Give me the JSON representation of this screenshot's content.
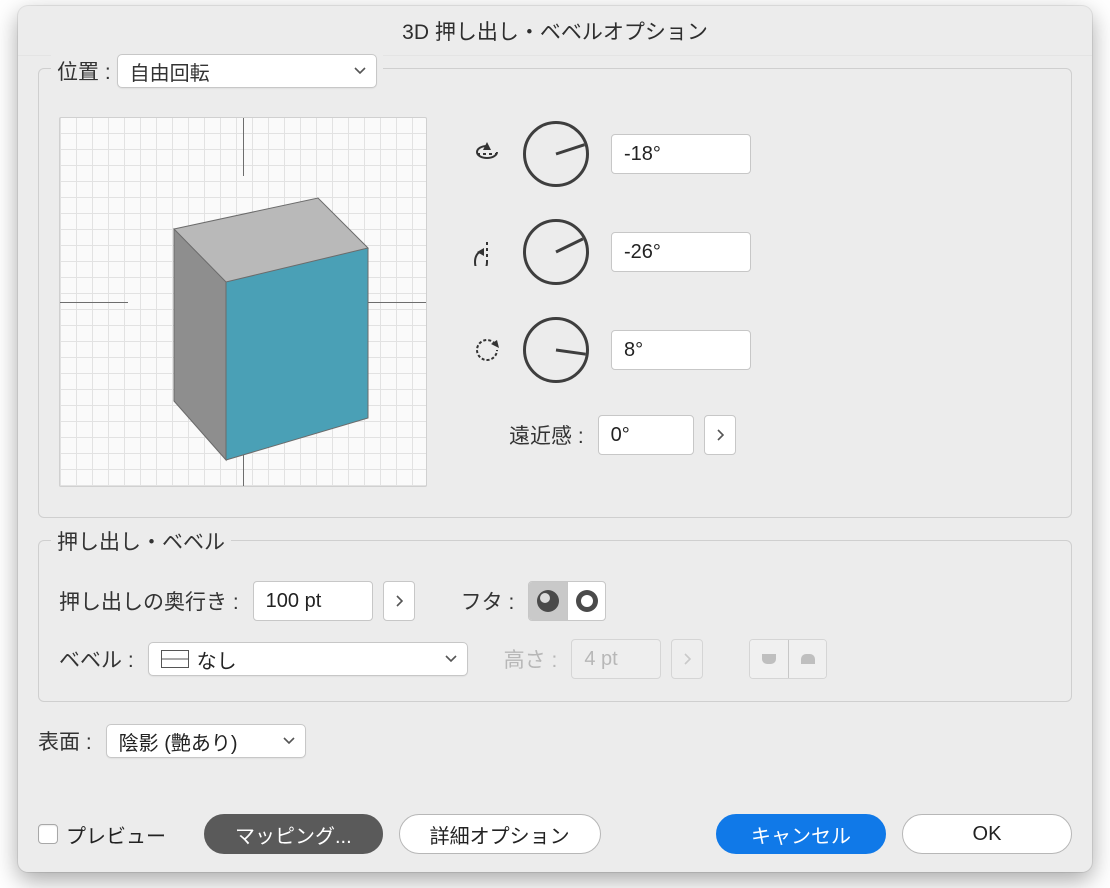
{
  "window": {
    "title": "3D 押し出し・ベベルオプション"
  },
  "position": {
    "legend": "位置 :",
    "preset": "自由回転",
    "rotate_x": "-18°",
    "rotate_y": "-26°",
    "rotate_z": "8°",
    "perspective_label": "遠近感 :",
    "perspective": "0°"
  },
  "extrude": {
    "legend": "押し出し・ベベル",
    "depth_label": "押し出しの奥行き :",
    "depth": "100 pt",
    "cap_label": "フタ :",
    "bevel_label": "ベベル :",
    "bevel_value": "なし",
    "height_label": "高さ :",
    "height": "4 pt"
  },
  "surface": {
    "label": "表面 :",
    "value": "陰影 (艶あり)"
  },
  "footer": {
    "preview": "プレビュー",
    "mapping": "マッピング...",
    "more": "詳細オプション",
    "cancel": "キャンセル",
    "ok": "OK"
  }
}
